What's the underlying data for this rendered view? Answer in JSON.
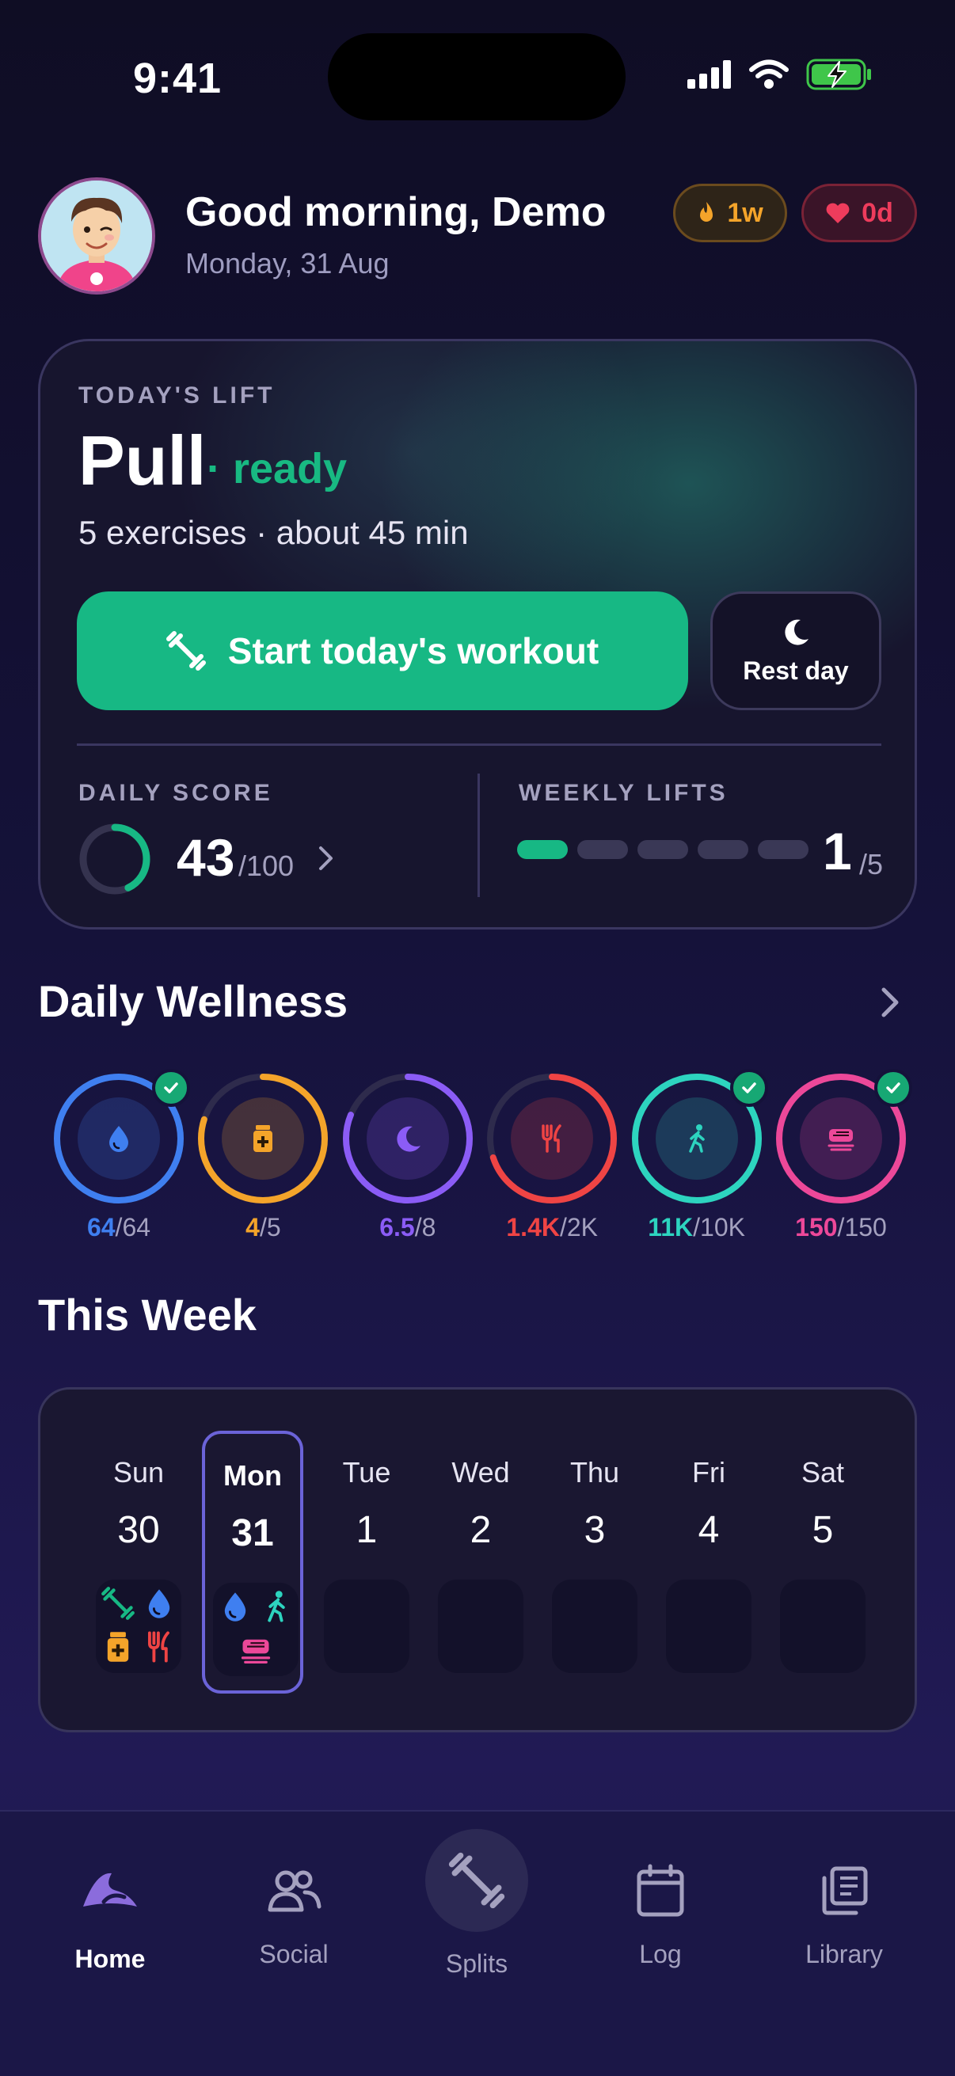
{
  "status_bar": {
    "time": "9:41"
  },
  "header": {
    "greeting": "Good morning, Demo",
    "date": "Monday, 31 Aug",
    "streak_badge": "1w",
    "hearts_badge": "0d"
  },
  "today_card": {
    "eyebrow": "TODAY'S LIFT",
    "title": "Pull",
    "status": "· ready",
    "meta": "5 exercises · about 45 min",
    "start_button": "Start today's workout",
    "rest_button": "Rest day",
    "daily_score_label": "DAILY SCORE",
    "daily_score": "43",
    "daily_score_max": "/100",
    "daily_score_fraction": 0.43,
    "weekly_lifts_label": "WEEKLY LIFTS",
    "weekly_lifts_done": "1",
    "weekly_lifts_total": "/5",
    "weekly_bars": [
      true,
      false,
      false,
      false,
      false
    ]
  },
  "wellness": {
    "title": "Daily Wellness",
    "rings": [
      {
        "name": "water",
        "icon": "water-drop-icon",
        "value": "64",
        "max": "/64",
        "progress": 1.0,
        "done": true,
        "color": "#3f7ff0"
      },
      {
        "name": "supplements",
        "icon": "pill-bottle-icon",
        "value": "4",
        "max": "/5",
        "progress": 0.8,
        "done": false,
        "color": "#f4a42a"
      },
      {
        "name": "sleep",
        "icon": "moon-icon",
        "value": "6.5",
        "max": "/8",
        "progress": 0.8125,
        "done": false,
        "color": "#8b5cf6"
      },
      {
        "name": "calories",
        "icon": "fork-knife-icon",
        "value": "1.4K",
        "max": "/2K",
        "progress": 0.7,
        "done": false,
        "color": "#ef4444"
      },
      {
        "name": "steps",
        "icon": "walking-icon",
        "value": "11K",
        "max": "/10K",
        "progress": 1.0,
        "done": true,
        "color": "#2dd4bf"
      },
      {
        "name": "protein",
        "icon": "meal-icon",
        "value": "150",
        "max": "/150",
        "progress": 1.0,
        "done": true,
        "color": "#ec4899"
      }
    ]
  },
  "this_week": {
    "title": "This Week",
    "days": [
      {
        "name": "Sun",
        "num": "30",
        "today": false,
        "icons": [
          "dumbbell-icon",
          "water-drop-icon",
          "pill-bottle-icon",
          "fork-knife-icon"
        ]
      },
      {
        "name": "Mon",
        "num": "31",
        "today": true,
        "icons": [
          "water-drop-icon",
          "walking-icon",
          "meal-icon"
        ]
      },
      {
        "name": "Tue",
        "num": "1",
        "today": false,
        "icons": []
      },
      {
        "name": "Wed",
        "num": "2",
        "today": false,
        "icons": []
      },
      {
        "name": "Thu",
        "num": "3",
        "today": false,
        "icons": []
      },
      {
        "name": "Fri",
        "num": "4",
        "today": false,
        "icons": []
      },
      {
        "name": "Sat",
        "num": "5",
        "today": false,
        "icons": []
      }
    ]
  },
  "nav": [
    {
      "label": "Home",
      "icon": "home-logo-icon",
      "active": true
    },
    {
      "label": "Social",
      "icon": "people-icon",
      "active": false
    },
    {
      "label": "Splits",
      "icon": "dumbbell-icon",
      "active": false
    },
    {
      "label": "Log",
      "icon": "calendar-icon",
      "active": false
    },
    {
      "label": "Library",
      "icon": "library-icon",
      "active": false
    }
  ],
  "colors": {
    "accent_green": "#17b884",
    "streak_orange": "#f4a42a",
    "hearts_red": "#ee3c5c",
    "today_outline": "#6b63d8"
  }
}
